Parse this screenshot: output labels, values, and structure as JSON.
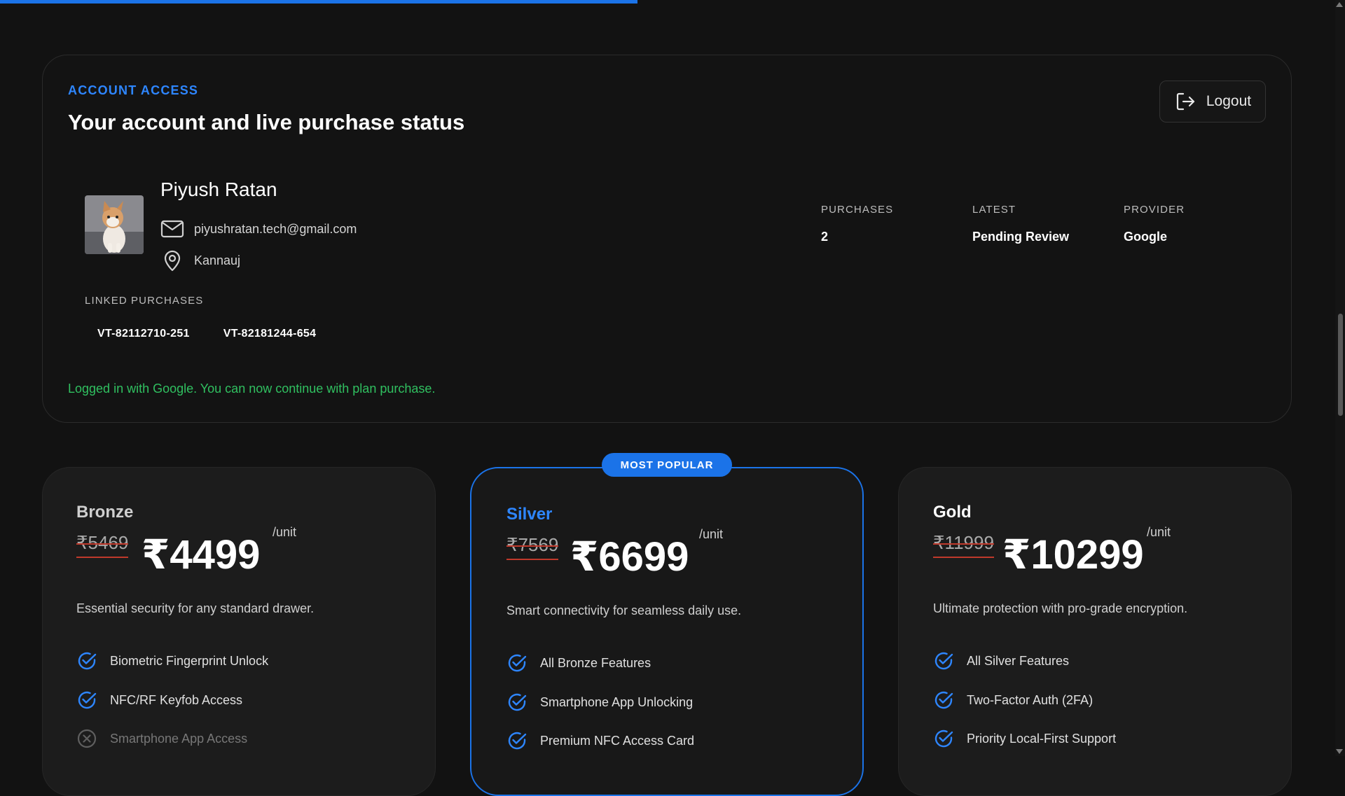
{
  "progress": {
    "fraction": 0.474,
    "color": "#1b73e8"
  },
  "account": {
    "eyebrow": "ACCOUNT ACCESS",
    "title": "Your account and live purchase status",
    "logout_label": "Logout",
    "user": {
      "name": "Piyush Ratan",
      "email": "piyushratan.tech@gmail.com",
      "city": "Kannauj"
    },
    "stats": [
      {
        "label": "PURCHASES",
        "value": "2"
      },
      {
        "label": "LATEST",
        "value": "Pending Review"
      },
      {
        "label": "PROVIDER",
        "value": "Google"
      }
    ],
    "linked_label": "LINKED PURCHASES",
    "linked_ids": [
      "VT-82112710-251",
      "VT-82181244-654"
    ],
    "status_message": "Logged in with Google. You can now continue with plan purchase."
  },
  "plans": [
    {
      "name": "Bronze",
      "old_price": "₹5469",
      "price": "₹4499",
      "unit": "/unit",
      "description": "Essential security for any standard drawer.",
      "features": [
        {
          "label": "Biometric Fingerprint Unlock",
          "included": true
        },
        {
          "label": "NFC/RF Keyfob Access",
          "included": true
        },
        {
          "label": "Smartphone App Access",
          "included": false
        }
      ]
    },
    {
      "name": "Silver",
      "badge": "MOST POPULAR",
      "old_price": "₹7569",
      "price": "₹6699",
      "unit": "/unit",
      "description": "Smart connectivity for seamless daily use.",
      "features": [
        {
          "label": "All Bronze Features",
          "included": true
        },
        {
          "label": "Smartphone App Unlocking",
          "included": true
        },
        {
          "label": "Premium NFC Access Card",
          "included": true
        }
      ]
    },
    {
      "name": "Gold",
      "old_price": "₹11999",
      "price": "₹10299",
      "unit": "/unit",
      "description": "Ultimate protection with pro-grade encryption.",
      "features": [
        {
          "label": "All Silver Features",
          "included": true
        },
        {
          "label": "Two-Factor Auth (2FA)",
          "included": true
        },
        {
          "label": "Priority Local-First Support",
          "included": true
        }
      ]
    }
  ],
  "colors": {
    "accent": "#1b73e8",
    "accent_text": "#2e86ff",
    "success": "#30c060",
    "strike": "#c0392b"
  },
  "icons": {
    "logout": "logout-icon",
    "email": "mail-icon",
    "location": "map-pin-icon",
    "check": "check-circle-icon",
    "excluded": "x-circle-icon"
  }
}
